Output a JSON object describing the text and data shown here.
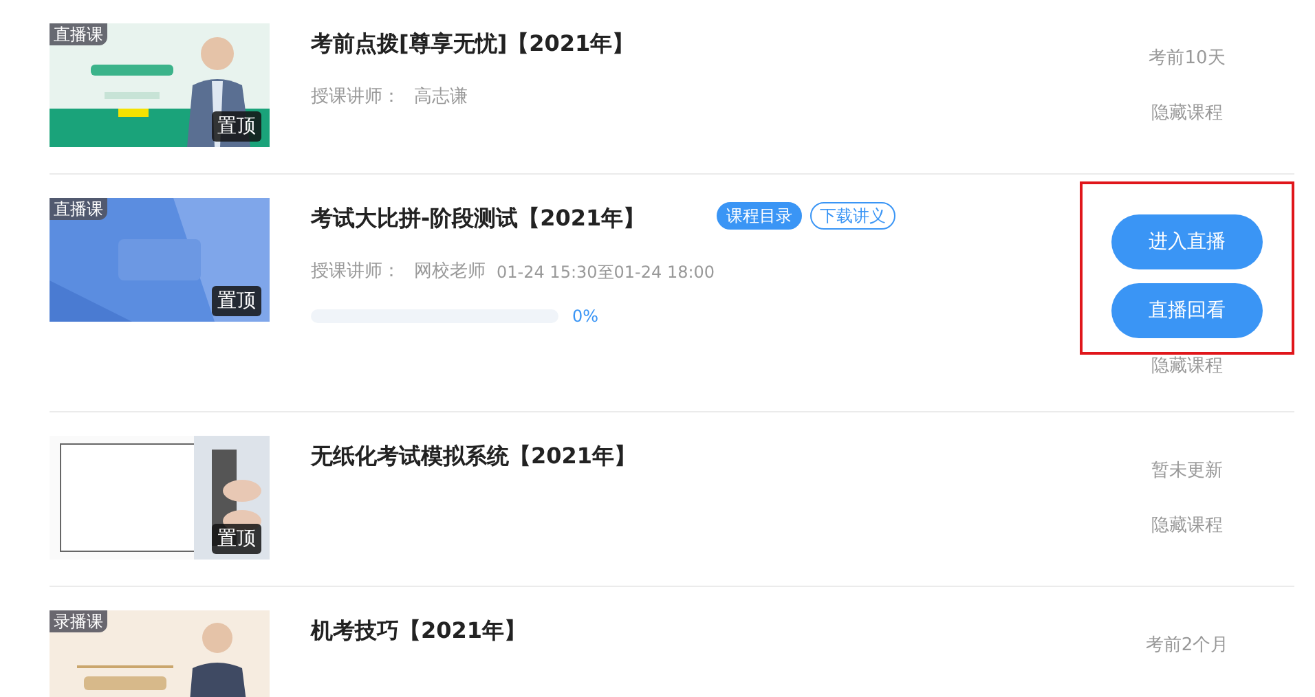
{
  "courses": [
    {
      "badge": "直播课",
      "pinned": "置顶",
      "title": "考前点拨[尊享无忧]【2021年】",
      "teacher_label": "授课讲师：",
      "teacher": "高志谦",
      "status": "考前10天",
      "hide_link": "隐藏课程",
      "highlighted": false
    },
    {
      "badge": "直播课",
      "pinned": "置顶",
      "title": "考试大比拼-阶段测试【2021年】",
      "tags": [
        {
          "label": "课程目录",
          "kind": "filled"
        },
        {
          "label": "下载讲义",
          "kind": "outline"
        }
      ],
      "teacher_label": "授课讲师：",
      "teacher": "网校老师",
      "schedule": "01-24 15:30至01-24 18:00",
      "progress": {
        "level": 0,
        "reading": "0%"
      },
      "buttons": [
        "进入直播",
        "直播回看"
      ],
      "hide_link": "隐藏课程",
      "highlighted": true
    },
    {
      "pinned": "置顶",
      "title": "无纸化考试模拟系统【2021年】",
      "status": "暂未更新",
      "hide_link": "隐藏课程",
      "highlighted": false
    },
    {
      "badge": "录播课",
      "title": "机考技巧【2021年】",
      "status": "考前2个月",
      "highlighted": false
    }
  ]
}
